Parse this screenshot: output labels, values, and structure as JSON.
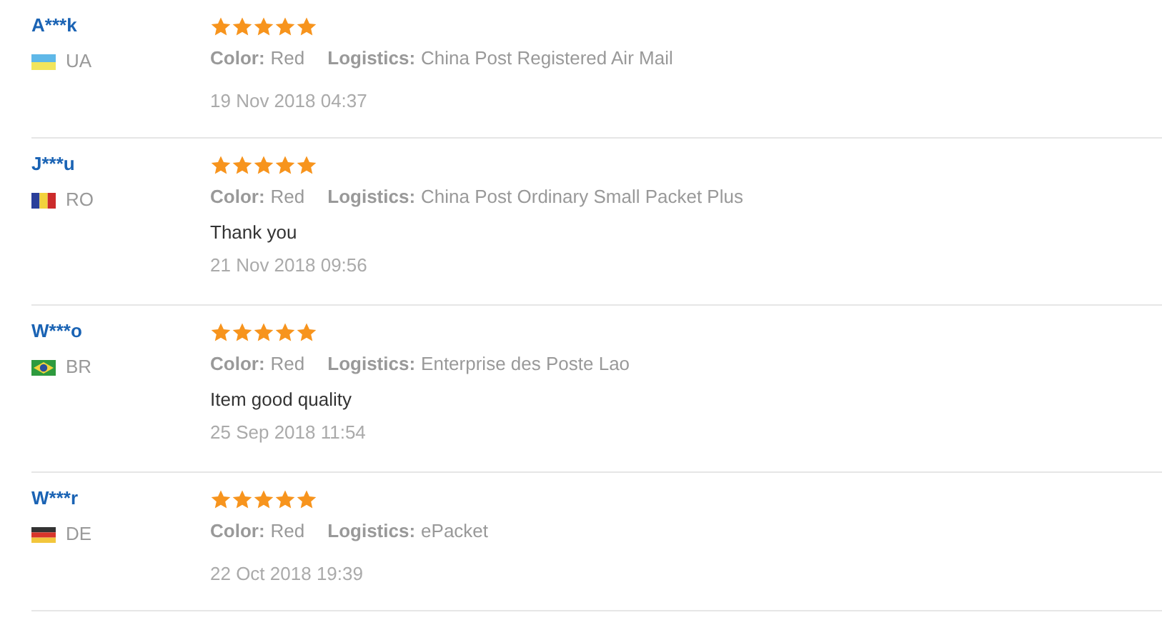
{
  "reviews": [
    {
      "buyer": "A***k",
      "country": "UA",
      "flag": {
        "kind": "ua"
      },
      "stars": 5,
      "color_label": "Color:",
      "color_value": "Red",
      "logistics_label": "Logistics:",
      "logistics_value": "China Post Registered Air Mail",
      "date": "19 Nov 2018 04:37"
    },
    {
      "buyer": "J***u",
      "country": "RO",
      "flag": {
        "kind": "ro"
      },
      "stars": 5,
      "color_label": "Color:",
      "color_value": "Red",
      "logistics_label": "Logistics:",
      "logistics_value": "China Post Ordinary Small Packet Plus",
      "comment": "Thank you",
      "date": "21 Nov 2018 09:56"
    },
    {
      "buyer": "W***o",
      "country": "BR",
      "flag": {
        "kind": "br"
      },
      "stars": 5,
      "color_label": "Color:",
      "color_value": "Red",
      "logistics_label": "Logistics:",
      "logistics_value": "Enterprise des Poste Lao",
      "comment": "Item good quality",
      "date": "25 Sep 2018 11:54"
    },
    {
      "buyer": "W***r",
      "country": "DE",
      "flag": {
        "kind": "de"
      },
      "stars": 5,
      "color_label": "Color:",
      "color_value": "Red",
      "logistics_label": "Logistics:",
      "logistics_value": "ePacket",
      "date": "22 Oct 2018 19:39"
    }
  ]
}
